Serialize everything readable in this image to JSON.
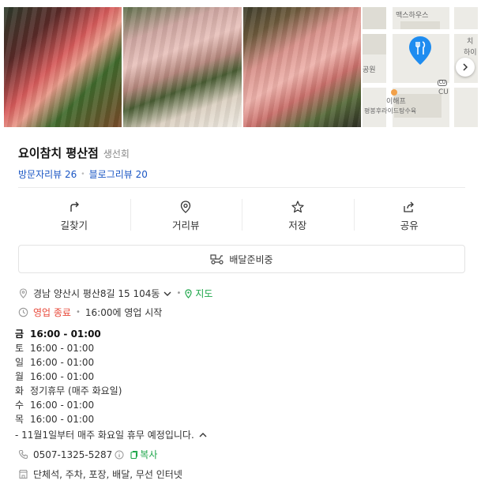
{
  "photos": [
    {
      "name": "photo-1",
      "alt": ""
    },
    {
      "name": "photo-2",
      "alt": ""
    },
    {
      "name": "photo-3",
      "alt": ""
    }
  ],
  "map": {
    "labels": [
      "맥스하우스",
      "CU",
      "CU",
      "이해프",
      "평봉후라이드탕수육",
      "치",
      "하이",
      "공원"
    ],
    "pin_color": "#1e8cf0"
  },
  "place": {
    "name": "요이참치 평산점",
    "category": "생선회",
    "visitor_reviews": "방문자리뷰 26",
    "blog_reviews": "블로그리뷰 20"
  },
  "actions": [
    {
      "label": "길찾기",
      "icon": "directions-icon"
    },
    {
      "label": "거리뷰",
      "icon": "street-view-icon"
    },
    {
      "label": "저장",
      "icon": "star-icon"
    },
    {
      "label": "공유",
      "icon": "share-icon"
    }
  ],
  "delivery": {
    "label": "배달준비중",
    "icon": "delivery-scooter-icon"
  },
  "address": {
    "text": "경남 양산시 평산8길 15 104동",
    "map_link": "지도"
  },
  "status": {
    "state": "영업 종료",
    "next": "16:00에 영업 시작"
  },
  "hours": [
    {
      "day": "금",
      "time": "16:00 - 01:00",
      "today": true
    },
    {
      "day": "토",
      "time": "16:00 - 01:00",
      "today": false
    },
    {
      "day": "일",
      "time": "16:00 - 01:00",
      "today": false
    },
    {
      "day": "월",
      "time": "16:00 - 01:00",
      "today": false
    },
    {
      "day": "화",
      "time": "정기휴무 (매주 화요일)",
      "today": false
    },
    {
      "day": "수",
      "time": "16:00 - 01:00",
      "today": false
    },
    {
      "day": "목",
      "time": "16:00 - 01:00",
      "today": false
    }
  ],
  "hours_notice": "- 11월1일부터 매주 화요일 휴무 예정입니다.",
  "phone": {
    "number": "0507-1325-5287",
    "copy_label": "복사"
  },
  "amenities": "단체석, 주차, 포장, 배달, 무선 인터넷",
  "colors": {
    "link": "#1a56c4",
    "green": "#1ea64a",
    "closed": "#e8493a"
  }
}
